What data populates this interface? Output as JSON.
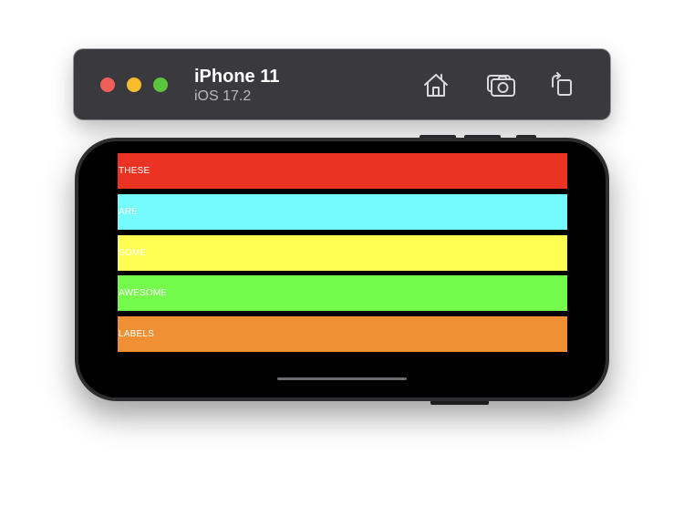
{
  "window": {
    "device_name": "iPhone 11",
    "os_version": "iOS 17.2"
  },
  "window_controls": {
    "close_color": "#ee5f57",
    "minimize_color": "#f7bd2f",
    "zoom_color": "#5bc540"
  },
  "toolbar": {
    "buttons": [
      {
        "name": "home",
        "icon": "home-icon"
      },
      {
        "name": "screenshot",
        "icon": "camera-icon"
      },
      {
        "name": "rotate",
        "icon": "rotate-icon"
      }
    ]
  },
  "app": {
    "labels": [
      {
        "text": "THESE",
        "color": "#eb3323"
      },
      {
        "text": "ARE",
        "color": "#75fbfd"
      },
      {
        "text": "SOME",
        "color": "#fffe53"
      },
      {
        "text": "AWESOME",
        "color": "#75fb4c"
      },
      {
        "text": "LABELS",
        "color": "#f09035"
      }
    ]
  }
}
